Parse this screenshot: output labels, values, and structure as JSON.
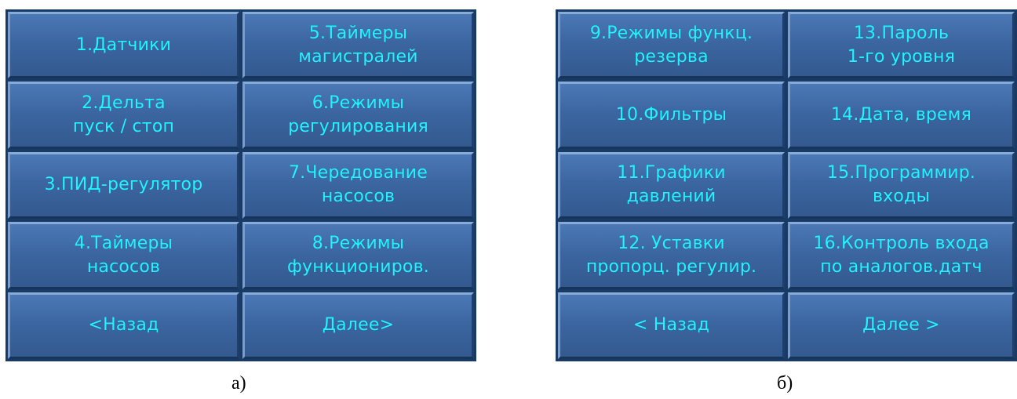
{
  "panel_a": {
    "buttons": [
      "1.Датчики",
      "5.Таймеры\nмагистралей",
      "2.Дельта\nпуск / стоп",
      "6.Режимы\nрегулирования",
      "3.ПИД-регулятор",
      "7.Чередование\nнасосов",
      "4.Таймеры\nнасосов",
      "8.Режимы\nфункциониров.",
      "<Назад",
      "Далее>"
    ],
    "caption": "а)"
  },
  "panel_b": {
    "buttons": [
      "9.Режимы функц.\nрезерва",
      "13.Пароль\n1-го уровня",
      "10.Фильтры",
      "14.Дата, время",
      "11.Графики\nдавлений",
      "15.Программир.\nвходы",
      "12. Уставки\nпропорц. регулир.",
      "16.Контроль входа\nпо аналогов.датч",
      "< Назад",
      "Далее >"
    ],
    "caption": "б)"
  },
  "colors": {
    "button_face": "#3c66a1",
    "button_text": "#22f4ff",
    "frame": "#183a66"
  }
}
